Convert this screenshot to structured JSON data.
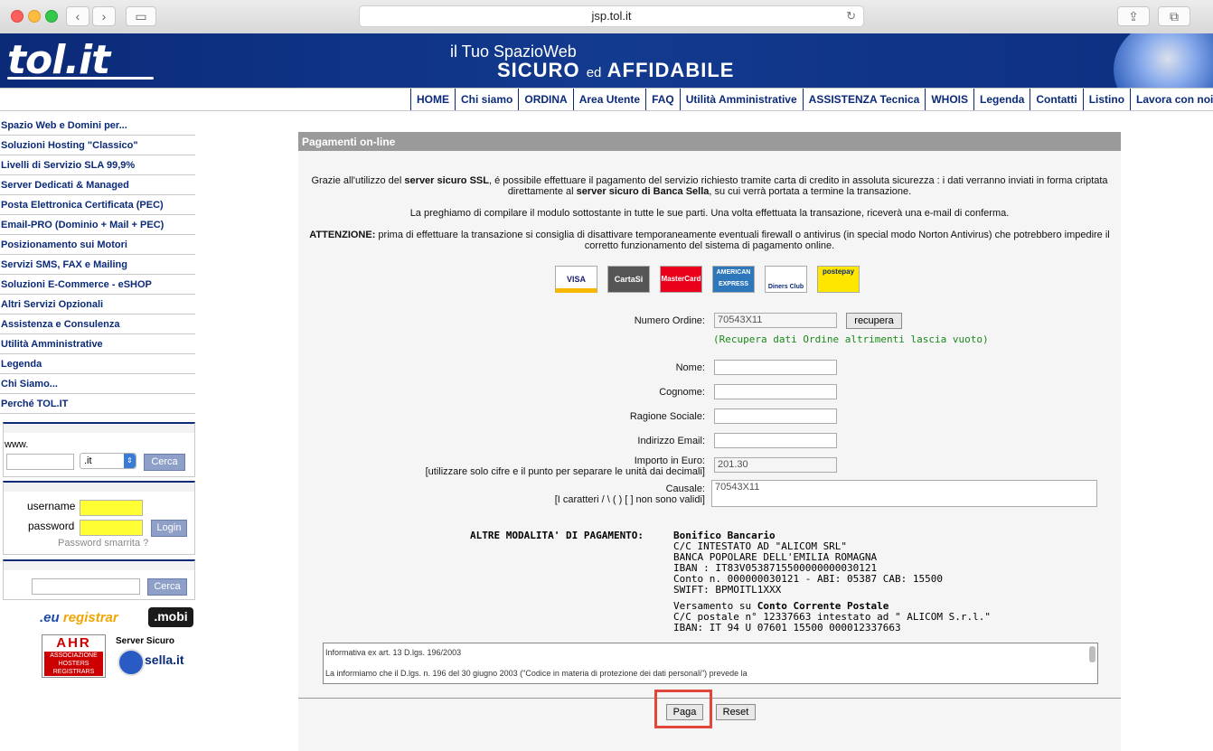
{
  "browser": {
    "url": "jsp.tol.it"
  },
  "header": {
    "logo": "tol.it",
    "tagline1": "il Tuo SpazioWeb",
    "tagline2_a": "SICURO",
    "tagline2_b": "ed",
    "tagline2_c": "AFFIDABILE"
  },
  "topnav": [
    "HOME",
    "Chi siamo",
    "ORDINA",
    "Area Utente",
    "FAQ",
    "Utilità Amministrative",
    "ASSISTENZA Tecnica",
    "WHOIS",
    "Legenda",
    "Contatti",
    "Listino",
    "Lavora con noi"
  ],
  "sidebar": {
    "items": [
      "Spazio Web e Domini per...",
      "Soluzioni Hosting \"Classico\"",
      "Livelli di Servizio SLA 99,9%",
      "Server Dedicati & Managed",
      "Posta Elettronica Certificata (PEC)",
      "Email-PRO (Dominio + Mail + PEC)",
      "Posizionamento sui Motori",
      "Servizi SMS, FAX e Mailing",
      "Soluzioni E-Commerce - eSHOP",
      "Altri Servizi Opzionali",
      "Assistenza e Consulenza",
      "Utilità Amministrative",
      "Legenda",
      "Chi Siamo...",
      "Perché TOL.IT"
    ],
    "domain": {
      "prefix": "www.",
      "tld": ".it",
      "button": "Cerca"
    },
    "login": {
      "username_label": "username",
      "password_label": "password",
      "button": "Login",
      "forgot": "Password smarrita ?"
    },
    "search": {
      "button": "Cerca"
    },
    "logos": {
      "eu_a": ".eu",
      "eu_b": " registrar",
      "mobi": ".mobi",
      "ahr": "AHR",
      "ahr_sub": "ASSOCIAZIONE HOSTERS REGISTRARS",
      "sella_title": "Server Sicuro",
      "sella": "sella.it"
    }
  },
  "main": {
    "title": "Pagamenti on-line",
    "intro1_a": "Grazie all'utilizzo del ",
    "intro1_b": "server sicuro SSL",
    "intro1_c": ", é possibile effettuare il pagamento del servizio richiesto tramite carta di credito in assoluta sicurezza : i dati verranno inviati in forma criptata",
    "intro1_d": "direttamente al ",
    "intro1_e": "server sicuro di Banca Sella",
    "intro1_f": ", su cui verrà portata a termine la transazione.",
    "intro2": "La preghiamo di compilare il modulo sottostante in tutte le sue parti. Una volta effettuata la transazione, riceverà una e-mail di conferma.",
    "intro3_a": "ATTENZIONE:",
    "intro3_b": " prima di effettuare la transazione si consiglia di disattivare temporaneamente eventuali firewall o antivirus (in special modo Norton Antivirus) che potrebbero impedire il",
    "intro3_c": "corretto funzionamento del sistema di pagamento online.",
    "cards": [
      "VISA",
      "CartaSi",
      "MasterCard",
      "AMERICAN EXPRESS",
      "Diners Club",
      "postepay"
    ],
    "form": {
      "ordine_label": "Numero Ordine:",
      "ordine_value": "70543X11",
      "recupera_btn": "recupera",
      "recupera_hint": "(Recupera dati Ordine altrimenti lascia vuoto)",
      "nome_label": "Nome:",
      "cognome_label": "Cognome:",
      "ragione_label": "Ragione Sociale:",
      "email_label": "Indirizzo Email:",
      "importo_label1": "Importo in Euro:",
      "importo_label2": "[utilizzare solo cifre e il punto per separare le unità dai decimali]",
      "importo_value": "201.30",
      "causale_label1": "Causale:",
      "causale_label2": "[I caratteri / \\ ( ) [ ] non sono validi]",
      "causale_value": "70543X11"
    },
    "alt": {
      "label": "ALTRE MODALITA' DI PAGAMENTO:",
      "bonifico_title": "Bonifico Bancario",
      "bonifico_lines": [
        "C/C INTESTATO AD \"ALICOM SRL\"",
        "BANCA POPOLARE DELL'EMILIA ROMAGNA",
        "IBAN : IT83V0538715500000000030121",
        "Conto n. 000000030121 - ABI: 05387 CAB: 15500",
        "SWIFT: BPMOITL1XXX"
      ],
      "postale_a": "Versamento su ",
      "postale_b": "Conto Corrente Postale",
      "postale_lines": [
        "C/C postale n° 12337663 intestato ad \" ALICOM S.r.l.\"",
        "IBAN: IT 94 U 07601 15500 000012337663"
      ]
    },
    "privacy": {
      "line1": "Informativa ex art. 13 D.lgs. 196/2003",
      "line2": "La informiamo che il D.lgs. n. 196 del 30 giugno 2003 (\"Codice in materia di protezione dei dati personali\") prevede la"
    },
    "buttons": {
      "paga": "Paga",
      "reset": "Reset"
    }
  }
}
